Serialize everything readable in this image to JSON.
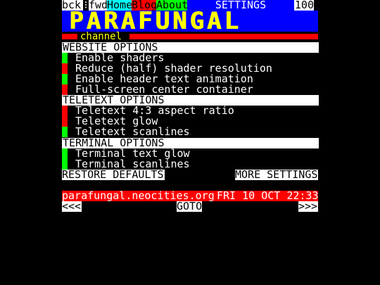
{
  "nav": {
    "back": "bck",
    "separator": "⁝",
    "forward": "fwd",
    "home": "Home",
    "blog": "Blog",
    "about": "About",
    "title": "SETTINGS",
    "page_number": "100"
  },
  "logo": {
    "title": "PARAFUNGAL",
    "subtitle": "channel"
  },
  "sections": [
    {
      "title": "WEBSITE OPTIONS",
      "options": [
        {
          "label": "Enable shaders",
          "state": "on"
        },
        {
          "label": "Reduce (half) shader resolution",
          "state": "off"
        },
        {
          "label": "Enable header text animation",
          "state": "on"
        },
        {
          "label": "Full-screen center container",
          "state": "off"
        }
      ]
    },
    {
      "title": "TELETEXT OPTIONS",
      "options": [
        {
          "label": "Teletext 4:3 aspect ratio",
          "state": "off"
        },
        {
          "label": "Teletext glow",
          "state": "off"
        },
        {
          "label": "Teletext scanlines",
          "state": "on"
        }
      ]
    },
    {
      "title": "TERMINAL OPTIONS",
      "options": [
        {
          "label": "Terminal text glow",
          "state": "on"
        },
        {
          "label": "Terminal scanlines",
          "state": "on"
        }
      ]
    }
  ],
  "buttons": {
    "restore": "RESTORE DEFAULTS",
    "more": "MORE SETTINGS"
  },
  "status": {
    "site": "parafungal.neocities.org",
    "datetime": "FRI 10 OCT 22:33"
  },
  "pager": {
    "prev": "<<<",
    "goto": "GOTO",
    "next": ">>>"
  },
  "colors": {
    "on": "#00ff00",
    "off": "#ff0000",
    "logo": "#ffff00",
    "logo_band": "#0000ff"
  }
}
